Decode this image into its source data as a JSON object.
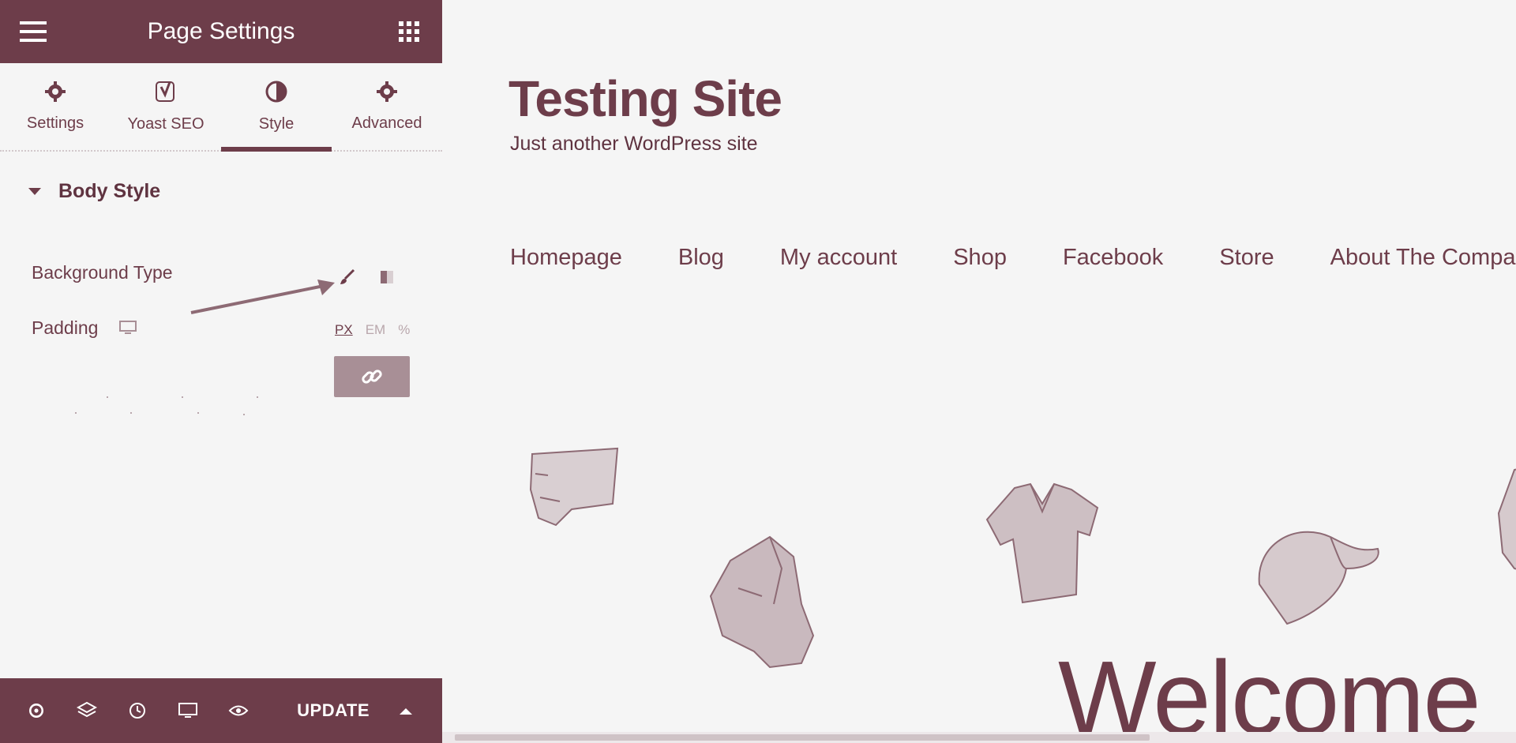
{
  "panel": {
    "title": "Page Settings",
    "tabs": [
      {
        "label": "Settings",
        "icon": "gear-icon"
      },
      {
        "label": "Yoast SEO",
        "icon": "yoast-icon"
      },
      {
        "label": "Style",
        "icon": "contrast-icon",
        "active": true
      },
      {
        "label": "Advanced",
        "icon": "gear-icon"
      }
    ],
    "section_title": "Body Style",
    "background_type_label": "Background Type",
    "padding_label": "Padding",
    "units": [
      "PX",
      "EM",
      "%"
    ],
    "active_unit": "PX",
    "update_label": "UPDATE"
  },
  "site": {
    "title": "Testing Site",
    "tagline": "Just another WordPress site",
    "nav": [
      "Homepage",
      "Blog",
      "My account",
      "Shop",
      "Facebook",
      "Store",
      "About The Compa"
    ],
    "welcome": "Welcome"
  },
  "colors": {
    "accent": "#6d3d4a",
    "background": "#f5f5f5"
  }
}
